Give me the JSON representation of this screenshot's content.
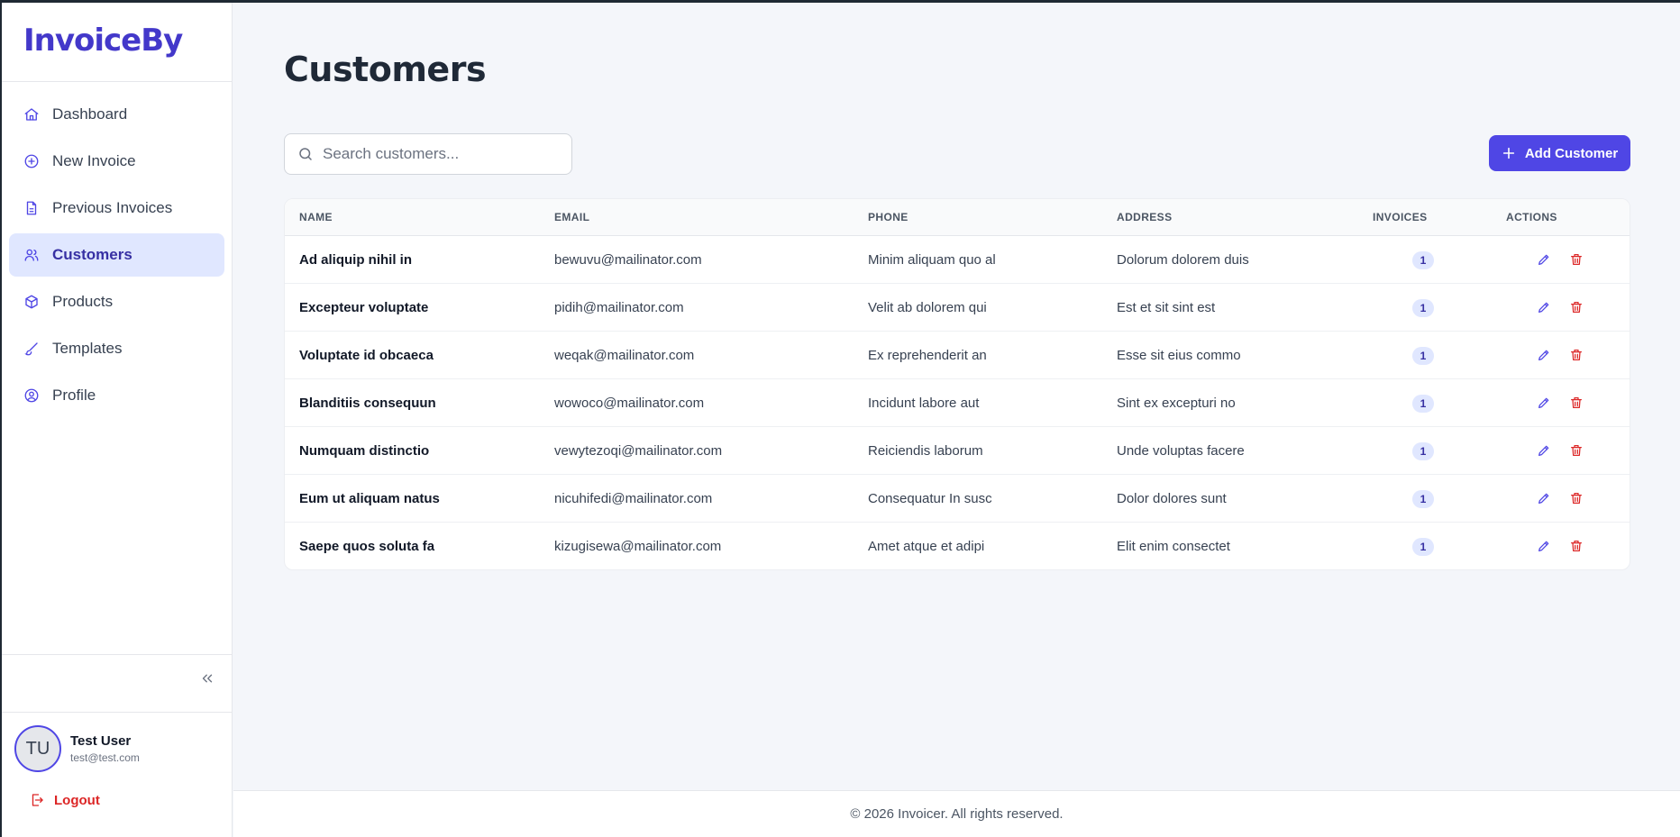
{
  "brand": "InvoiceBy",
  "sidebar": {
    "items": [
      {
        "label": "Dashboard",
        "icon": "home-icon"
      },
      {
        "label": "New Invoice",
        "icon": "plus-circle-icon"
      },
      {
        "label": "Previous Invoices",
        "icon": "file-icon"
      },
      {
        "label": "Customers",
        "icon": "users-icon",
        "active": true
      },
      {
        "label": "Products",
        "icon": "box-icon"
      },
      {
        "label": "Templates",
        "icon": "brush-icon"
      },
      {
        "label": "Profile",
        "icon": "user-circle-icon"
      }
    ]
  },
  "user": {
    "initials": "TU",
    "name": "Test User",
    "email": "test@test.com"
  },
  "logout_label": "Logout",
  "page_title": "Customers",
  "search": {
    "placeholder": "Search customers..."
  },
  "add_button_label": "Add Customer",
  "table": {
    "headers": [
      "NAME",
      "EMAIL",
      "PHONE",
      "ADDRESS",
      "INVOICES",
      "ACTIONS"
    ],
    "rows": [
      {
        "name": "Ad aliquip nihil in",
        "email": "bewuvu@mailinator.com",
        "phone": "Minim aliquam quo al",
        "address": "Dolorum dolorem duis",
        "invoices": "1"
      },
      {
        "name": "Excepteur voluptate",
        "email": "pidih@mailinator.com",
        "phone": "Velit ab dolorem qui",
        "address": "Est et sit sint est",
        "invoices": "1"
      },
      {
        "name": "Voluptate id obcaeca",
        "email": "weqak@mailinator.com",
        "phone": "Ex reprehenderit an",
        "address": "Esse sit eius commo",
        "invoices": "1"
      },
      {
        "name": "Blanditiis consequun",
        "email": "wowoco@mailinator.com",
        "phone": "Incidunt labore aut",
        "address": "Sint ex excepturi no",
        "invoices": "1"
      },
      {
        "name": "Numquam distinctio",
        "email": "vewytezoqi@mailinator.com",
        "phone": "Reiciendis laborum",
        "address": "Unde voluptas facere",
        "invoices": "1"
      },
      {
        "name": "Eum ut aliquam natus",
        "email": "nicuhifedi@mailinator.com",
        "phone": "Consequatur In susc",
        "address": "Dolor dolores sunt",
        "invoices": "1"
      },
      {
        "name": "Saepe quos soluta fa",
        "email": "kizugisewa@mailinator.com",
        "phone": "Amet atque et adipi",
        "address": "Elit enim consectet",
        "invoices": "1"
      }
    ]
  },
  "footer": "© 2026 Invoicer. All rights reserved.",
  "colors": {
    "accent": "#4f46e5",
    "brand": "#4338ca",
    "danger": "#dc2626",
    "active_bg": "#e0e7ff"
  }
}
